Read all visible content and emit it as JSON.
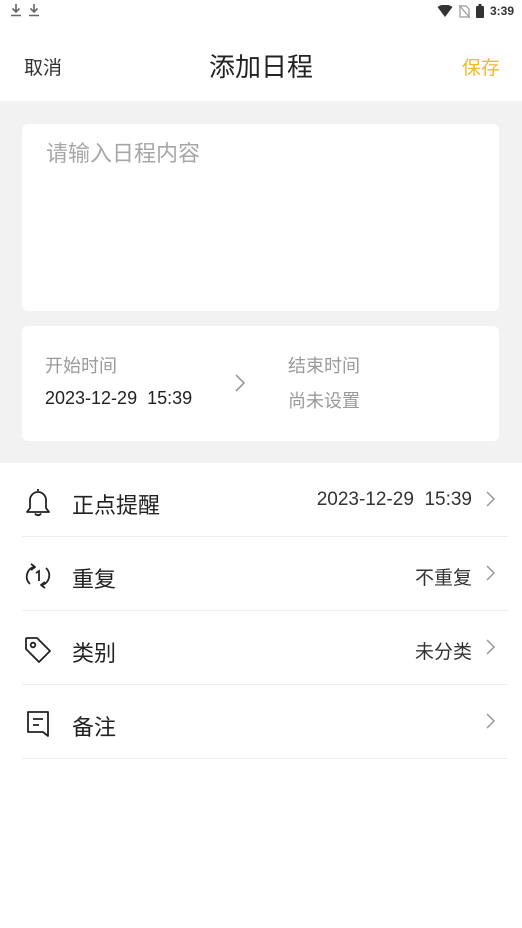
{
  "status_bar": {
    "time": "3:39",
    "left_icons": [
      "download-icon",
      "download-icon"
    ],
    "right_icons": [
      "wifi-icon",
      "no-sim-icon",
      "battery-icon"
    ]
  },
  "nav": {
    "cancel_label": "取消",
    "title": "添加日程",
    "save_label": "保存",
    "accent_color": "#f5b82a"
  },
  "content_input": {
    "placeholder": "请输入日程内容",
    "value": ""
  },
  "time": {
    "start_label": "开始时间",
    "start_value": "2023-12-29  15:39",
    "end_label": "结束时间",
    "end_value": "尚未设置"
  },
  "settings": [
    {
      "icon": "bell-icon",
      "label": "正点提醒",
      "value": "2023-12-29  15:39"
    },
    {
      "icon": "repeat-icon",
      "label": "重复",
      "value": "不重复"
    },
    {
      "icon": "tag-icon",
      "label": "类别",
      "value": "未分类"
    },
    {
      "icon": "note-icon",
      "label": "备注",
      "value": ""
    }
  ]
}
